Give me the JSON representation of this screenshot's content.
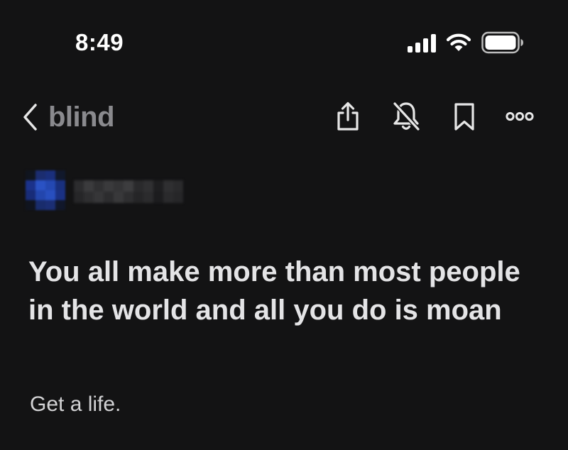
{
  "status_bar": {
    "time": "8:49",
    "signal_icon": "cellular-signal-icon",
    "wifi_icon": "wifi-icon",
    "battery_icon": "battery-icon"
  },
  "nav": {
    "back_icon": "chevron-left-icon",
    "logo": "blind",
    "actions": [
      "share-icon",
      "bell-off-icon",
      "bookmark-icon",
      "more-icon"
    ]
  },
  "author": {
    "avatar": "pixelated-avatar",
    "name_redacted": true
  },
  "post": {
    "title": "You all make more than most people in the world and all you do is moan",
    "body": "Get a life."
  },
  "colors": {
    "background": "#131314",
    "text_primary": "#e4e4e6",
    "text_muted": "#8a8a8e",
    "icon": "#e6e6e6",
    "avatar_blue": "#1a3fa8"
  }
}
